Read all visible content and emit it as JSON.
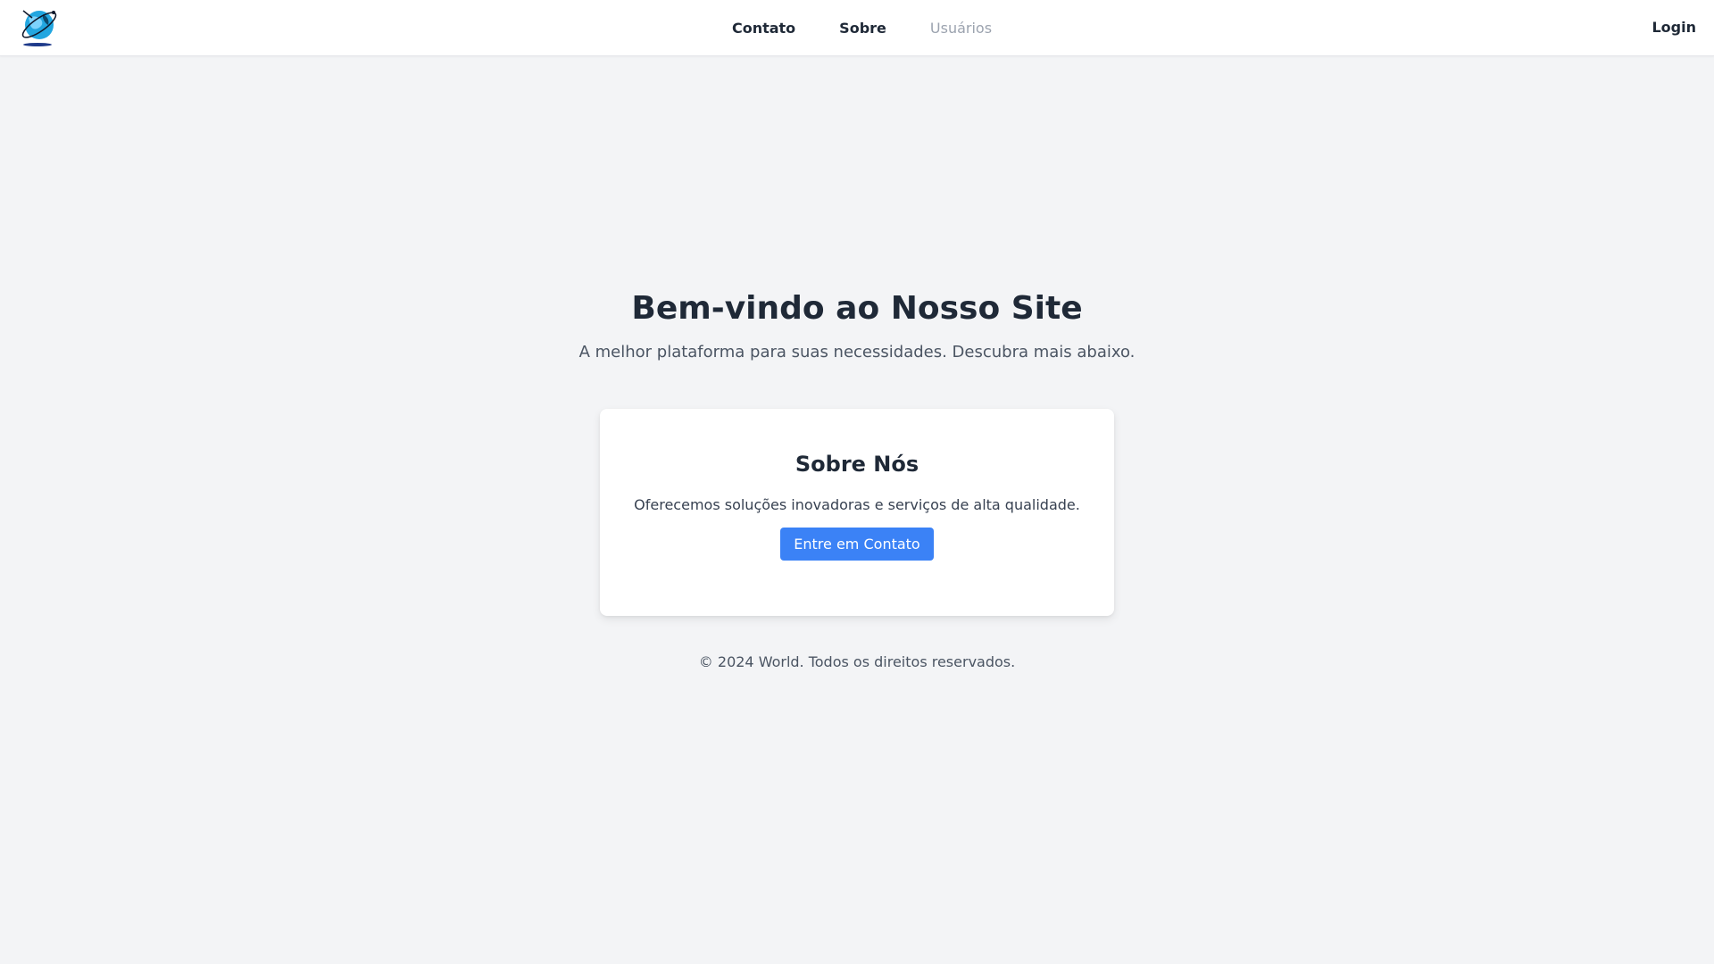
{
  "nav": {
    "logo_icon": "globe-logo-icon",
    "links": [
      {
        "label": "Contato"
      },
      {
        "label": "Sobre"
      },
      {
        "label": "Usuários"
      }
    ],
    "login_label": "Login"
  },
  "hero": {
    "title": "Bem-vindo ao Nosso Site",
    "subtitle": "A melhor plataforma para suas necessidades. Descubra mais abaixo."
  },
  "card": {
    "title": "Sobre Nós",
    "text": "Oferecemos soluções inovadoras e serviços de alta qualidade.",
    "button_label": "Entre em Contato"
  },
  "footer": {
    "text": "© 2024 World. Todos os direitos reservados."
  },
  "colors": {
    "accent": "#3b82f6",
    "background": "#f3f4f6",
    "disabled_link": "#9ca3af"
  }
}
